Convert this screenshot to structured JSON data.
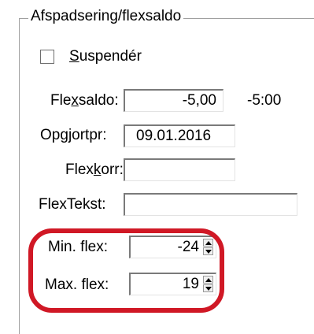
{
  "group": {
    "title": "Afspadsering/flexsaldo"
  },
  "suspender": {
    "label_pre": "",
    "label_u": "S",
    "label_post": "uspendér",
    "checked": false
  },
  "flexsaldo": {
    "label_pre": "Fle",
    "label_u": "x",
    "label_post": "saldo:",
    "value": "-5,00",
    "hours": "-5:00"
  },
  "opgjortpr": {
    "label_pre": "Op",
    "label_u": "g",
    "label_post": "jortpr:",
    "value": "09.01.2016"
  },
  "flexkorr": {
    "label_pre": "Flex",
    "label_u": "k",
    "label_post": "orr:",
    "value": ""
  },
  "flextekst": {
    "label": "FlexTekst:",
    "value": ""
  },
  "min_flex": {
    "label": "Min. flex:",
    "value": "-24"
  },
  "max_flex": {
    "label": "Max. flex:",
    "value": "19"
  },
  "colors": {
    "highlight": "#d01825"
  }
}
